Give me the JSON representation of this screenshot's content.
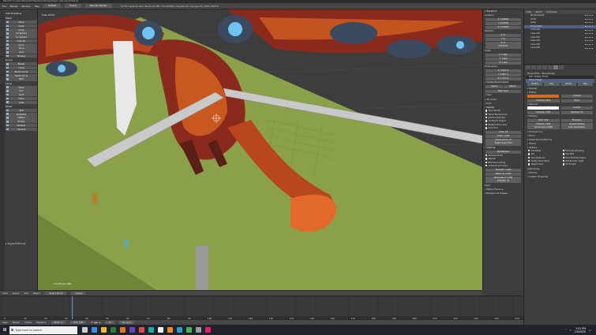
{
  "titlebar": {
    "text": "Blender* [C:\\Users\\Mary\\3D Objects\\Creatures\\dragon_test_layout.blend]"
  },
  "topbar": {
    "menus": [
      "File",
      "Render",
      "Window",
      "Help"
    ],
    "layout": "Default",
    "scene": "Scene",
    "engine": "Blender Render",
    "stats": "v2.79 | Verts:51,224 | Faces:49,780 | Tris:99,560 | Objects:1/9 | Lamps:0/1 | Mem:28.8 M"
  },
  "toolshelf": {
    "sections": [
      {
        "title": "Add Primitive",
        "buttons": []
      },
      {
        "title": "Mesh",
        "buttons": [
          "Plane",
          "Cube",
          "Circle",
          "UV Sphere",
          "Ico Sphere",
          "Cylinder",
          "Cone",
          "Torus",
          "Grid",
          "Monkey"
        ]
      },
      {
        "title": "Curve",
        "buttons": [
          "Bezier",
          "Circle",
          "Nurbs Curve",
          "Nurbs Circle",
          "Path"
        ]
      },
      {
        "title": "Lamp",
        "buttons": [
          "Point",
          "Sun",
          "Spot",
          "Hemi",
          "Area"
        ]
      },
      {
        "title": "Other",
        "buttons": [
          "Text",
          "Armature",
          "Lattice",
          "Empty",
          "Speaker",
          "Camera"
        ]
      }
    ],
    "toggle_history": "▸ Toggle Editmode"
  },
  "viewport": {
    "label": "User Ortho",
    "info": "(33) Phoenix004",
    "colors": {
      "floor": "#8aa14a",
      "bg": "#3d3d3d",
      "grid": "#505050"
    }
  },
  "viewport_header": {
    "items": [
      "View",
      "Select",
      "Add",
      "Object"
    ],
    "mode": "Object Mode",
    "shading": "Global"
  },
  "npanel": {
    "location_label": "Location:",
    "location": [
      "X: 0.00000",
      "Y: 0.00000",
      "Z: 0.00000"
    ],
    "rotation_label": "Rotation:",
    "rotation": [
      "X: 0°",
      "Y: 0°",
      "Z: 0°"
    ],
    "rotation_mode": "XYZ Euler",
    "scale_label": "Scale:",
    "scale": [
      "X: 1.000",
      "Y: 1.000",
      "Z: 1.000"
    ],
    "dimensions_label": "Dimensions:",
    "dimensions": [
      "X: 2.931 m",
      "Y: 5.887 m",
      "Z: 2.775 m"
    ],
    "grease_pencil": "Grease Pencil Layers",
    "gp_tabs": [
      "Scene",
      "Object"
    ],
    "new_layer": "New Layer",
    "view_label": "View",
    "cursor_label": "3D Cursor",
    "item_label": "Item",
    "display_label": "Display",
    "display_checks": [
      "Only Render",
      "World Background",
      "Outline Selected",
      "All Object Origins",
      "Relationship Lines",
      "Grid Floor"
    ],
    "grid_fields": [
      "Lines: 16",
      "Scale: 1.000",
      "Subdivisions: 10"
    ],
    "toggle_quad": "Toggle Quad View",
    "shading_label": "Shading",
    "shading_mode": "Multitexture",
    "shading_checks": [
      "Textured Solid",
      "Matcap",
      "Backface Culling",
      "Ambient Occlusion"
    ],
    "ao_fields": [
      "Strength: 1.000",
      "Distance: 0.200",
      "Attenuation: 1.000",
      "Samples: 20"
    ],
    "color_label": "Color:",
    "motion_tracking": "Motion Tracking",
    "background_images": "Background Images"
  },
  "outliner": {
    "tabs": [
      "View",
      "Search",
      "All Scenes"
    ],
    "items": [
      "RenderLayers",
      "World",
      "Lamp",
      "Phoenix004",
      "Cube.001",
      "Cube.002",
      "Cube.003",
      "Cube.004",
      "Cube.005",
      "Cube.006"
    ],
    "selected_index": 3
  },
  "properties": {
    "object_name": "Phoenix004",
    "material_tab": "Wing Orange",
    "slots": [
      "Dark Feather Brown",
      "Wing Orange"
    ],
    "selected_slot": 1,
    "tabs_row": [
      "Surface",
      "Wire",
      "Volume",
      "Halo"
    ],
    "preview": "Preview",
    "diffuse": "Diffuse",
    "diffuse_fields": [
      "Lambert",
      "Intensity: 0.800",
      "Ramp"
    ],
    "specular": "Specular",
    "specular_fields": [
      "CookTorr",
      "Intensity: 0.500",
      "Hardness: 50"
    ],
    "shading": "Shading",
    "shading_fields": [
      "Emit: 0.00",
      "Ambient: 1.000",
      "Translucency: 0.000",
      "Shadeless",
      "Tangent Shading",
      "Cubic Interpolation"
    ],
    "transparency": "Transparency",
    "mirror": "Mirror",
    "sss": "Subsurface Scattering",
    "strand": "Strand",
    "options": "Options",
    "option_checks": [
      "Traceable",
      "Full Oversampling",
      "Sky",
      "Use Mist",
      "Face Textures",
      "Face Textures Alpha",
      "Vertex Color Paint",
      "Vertex Color Light",
      "Object Color",
      "UV Project"
    ],
    "light_group": "Light Group:",
    "shadow": "Shadow",
    "custom_props": "Custom Properties",
    "colors": {
      "diffuse": "#d86a1e",
      "specular": "#ffffff"
    }
  },
  "timeline": {
    "ticks": [
      "0",
      "10",
      "20",
      "30",
      "40",
      "50",
      "60",
      "70",
      "80",
      "90",
      "100",
      "110",
      "120",
      "130",
      "140",
      "150",
      "160",
      "170",
      "180",
      "190",
      "200",
      "210",
      "220",
      "230",
      "240",
      "250"
    ],
    "current_frame": 33
  },
  "timeline_header": {
    "items": [
      "View",
      "Marker",
      "Frame",
      "Playback"
    ],
    "start": "Start: 1",
    "end": "End: 250",
    "frame": "33",
    "sync": "No Sync"
  },
  "taskbar": {
    "search_placeholder": "Type here to search",
    "time": "3:51 PM",
    "date": "1/9/2020",
    "app_colors": [
      "#d0d0d0",
      "#3a8ee6",
      "#f3b92c",
      "#2e7d32",
      "#e8742c",
      "#6f42c1",
      "#e34a4a",
      "#22a6a6",
      "#f5f5f5",
      "#f08a24",
      "#2e9ad0",
      "#4caf50",
      "#9e9e9e",
      "#e91e63"
    ]
  }
}
